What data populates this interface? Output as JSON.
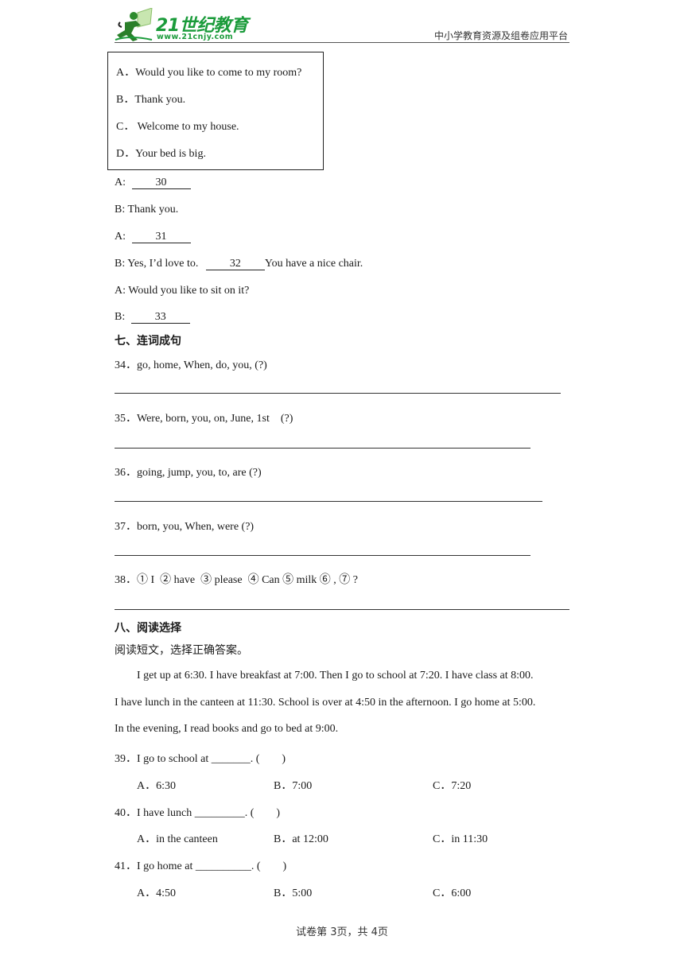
{
  "header": {
    "logo_text": "21世纪教育",
    "logo_url": "www.21cnjy.com",
    "platform": "中小学教育资源及组卷应用平台",
    "brand_color": "#1a9b3a"
  },
  "option_box": {
    "options": [
      {
        "letter": "A．",
        "text": "Would you like to come to my room?"
      },
      {
        "letter": "B．",
        "text": "Thank you."
      },
      {
        "letter": "C．",
        "text": " Welcome to my house."
      },
      {
        "letter": "D．",
        "text": "Your bed is big."
      }
    ]
  },
  "dialogue": [
    {
      "speaker": "A:",
      "blank": "30",
      "after": ""
    },
    {
      "speaker": "B: Thank you.",
      "blank": null,
      "after": ""
    },
    {
      "speaker": "A:",
      "blank": "31",
      "after": ""
    },
    {
      "speaker": "B: Yes, I’d love to.",
      "blank": "32",
      "after": "You have a nice chair."
    },
    {
      "speaker": "A: Would you like to sit on it?",
      "blank": null,
      "after": ""
    },
    {
      "speaker": "B:",
      "blank": "33",
      "after": ""
    }
  ],
  "section7": {
    "title": "七、连词成句",
    "questions": [
      {
        "num": "34．",
        "text": "go, home, When, do, you, (?)"
      },
      {
        "num": "35．",
        "text": "Were, born, you, on, June, 1st    (?)"
      },
      {
        "num": "36．",
        "text": "going, jump, you, to, are (?)"
      },
      {
        "num": "37．",
        "text": "born, you, When, were (?)"
      },
      {
        "num": "38．",
        "text": "① I  ② have  ③ please  ④ Can ⑤ milk ⑥ , ⑦ ?"
      }
    ]
  },
  "section8": {
    "title": "八、阅读选择",
    "instruction": "阅读短文，选择正确答案。",
    "passage": [
      "I get up at 6:30. I have breakfast at 7:00. Then I go to school at 7:20. I have class at 8:00.",
      "I have lunch in the canteen at 11:30. School is over at 4:50 in the afternoon. I go home at 5:00.",
      "In the evening, I read books and go to bed at 9:00."
    ],
    "questions": [
      {
        "num": "39．",
        "text": "I go to school at _______. (        )",
        "options": [
          {
            "letter": "A．",
            "text": "6:30"
          },
          {
            "letter": "B．",
            "text": "7:00"
          },
          {
            "letter": "C．",
            "text": "7:20"
          }
        ]
      },
      {
        "num": "40．",
        "text": "I have lunch _________. (        )",
        "options": [
          {
            "letter": "A．",
            "text": "in the canteen"
          },
          {
            "letter": "B．",
            "text": "at 12:00"
          },
          {
            "letter": "C．",
            "text": "in 11:30"
          }
        ]
      },
      {
        "num": "41．",
        "text": "I go home at __________. (        )",
        "options": [
          {
            "letter": "A．",
            "text": "4:50"
          },
          {
            "letter": "B．",
            "text": "5:00"
          },
          {
            "letter": "C．",
            "text": "6:00"
          }
        ]
      }
    ]
  },
  "footer": {
    "page_info": "试卷第 3页，共 4页"
  }
}
